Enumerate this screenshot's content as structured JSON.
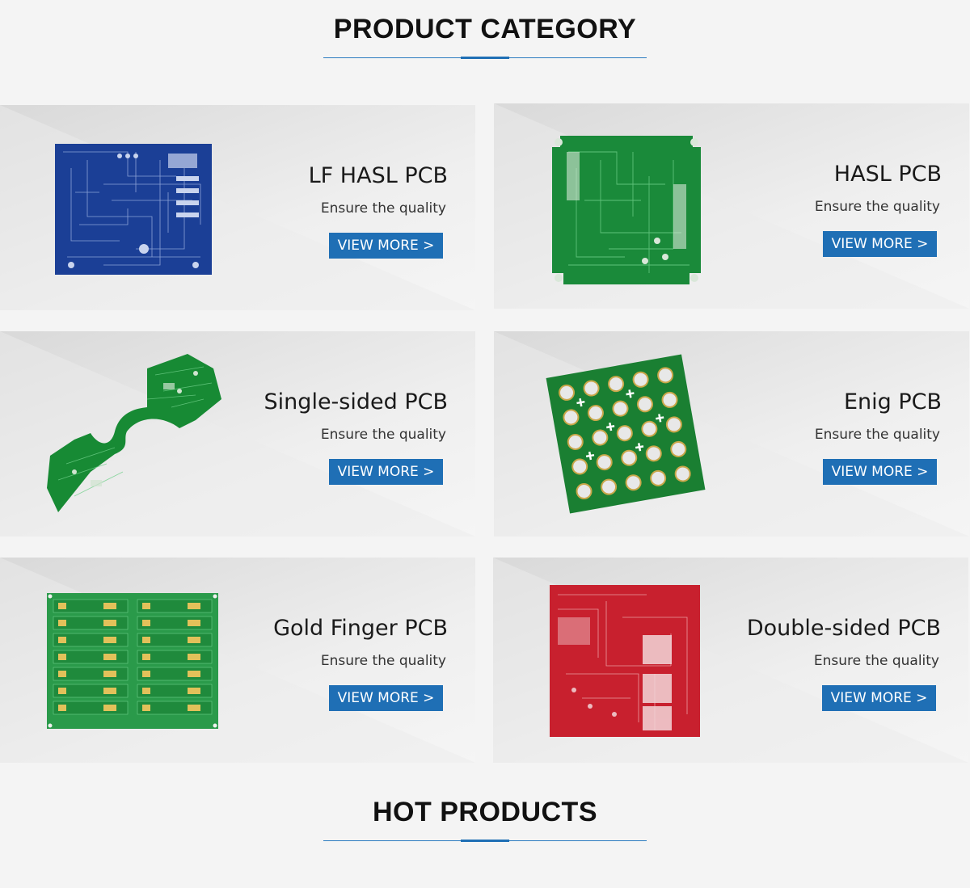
{
  "sections": {
    "product_category": "PRODUCT CATEGORY",
    "hot_products": "HOT PRODUCTS"
  },
  "colors": {
    "accent": "#1f6fb5",
    "background": "#f4f4f4"
  },
  "products": [
    {
      "name": "LF HASL PCB",
      "tagline": "Ensure the quality",
      "button": "VIEW MORE >",
      "board": "blue-pcb-image"
    },
    {
      "name": "HASL PCB",
      "tagline": "Ensure the quality",
      "button": "VIEW MORE >",
      "board": "green-pcb-image"
    },
    {
      "name": "Single-sided PCB",
      "tagline": "Ensure the quality",
      "button": "VIEW MORE >",
      "board": "green-shaped-pcb-image"
    },
    {
      "name": "Enig PCB",
      "tagline": "Ensure the quality",
      "button": "VIEW MORE >",
      "board": "green-led-panel-pcb-image"
    },
    {
      "name": "Gold Finger PCB",
      "tagline": "Ensure the quality",
      "button": "VIEW MORE >",
      "board": "green-gold-finger-panel-image"
    },
    {
      "name": "Double-sided PCB",
      "tagline": "Ensure the quality",
      "button": "VIEW MORE >",
      "board": "red-pcb-image"
    }
  ]
}
